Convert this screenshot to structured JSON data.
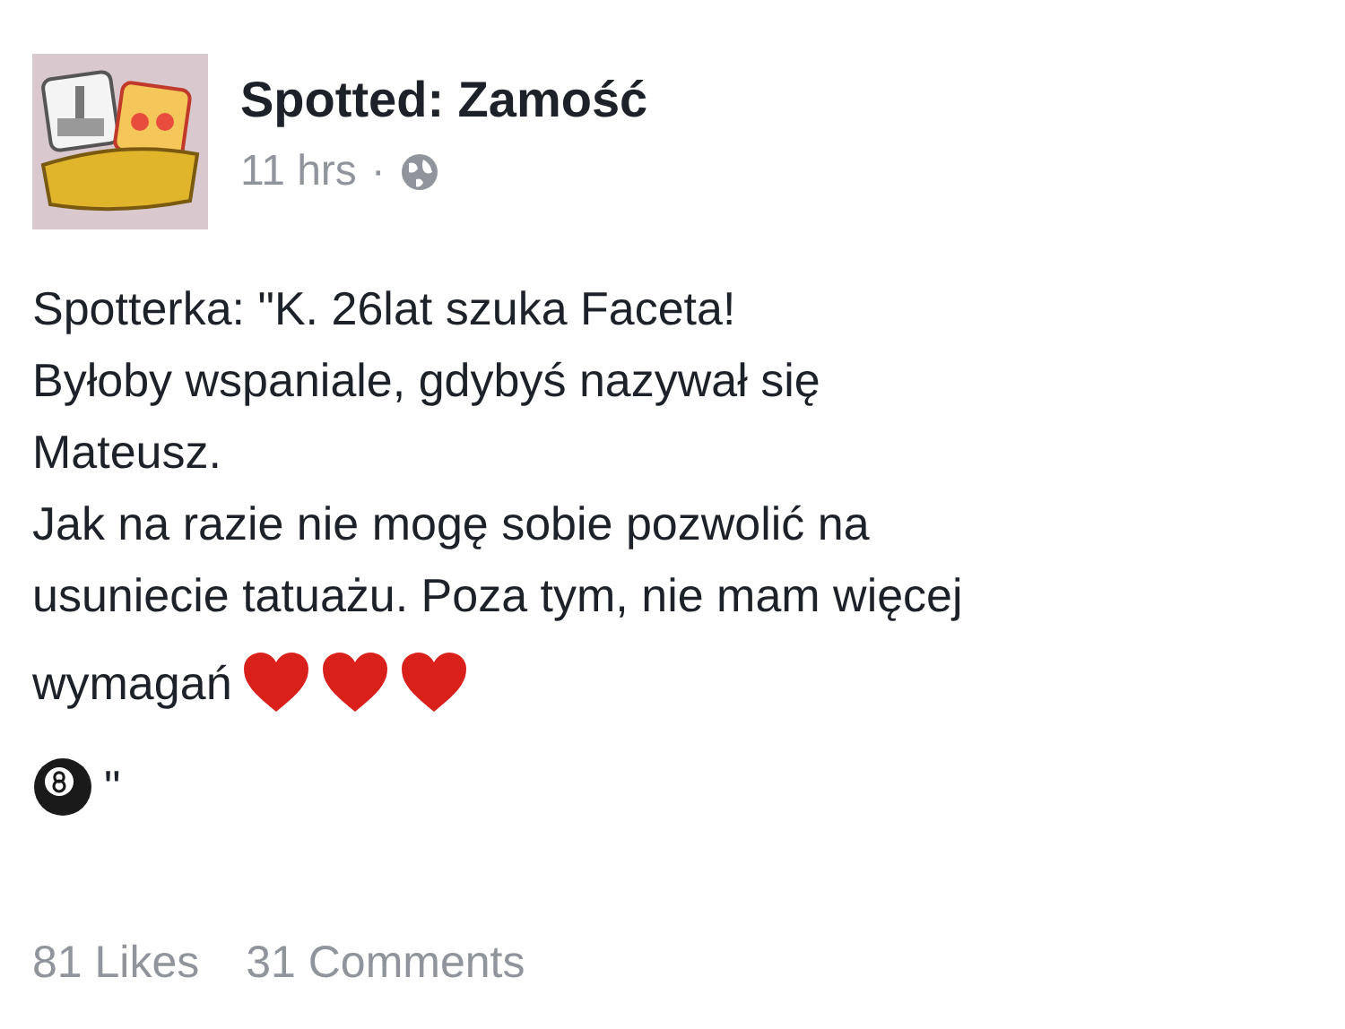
{
  "post": {
    "author": "Spotted: Zamość",
    "time": "11 hrs",
    "separator": "·",
    "audience": {
      "kind": "globe"
    },
    "lines": [
      {
        "text": "Spotterka: \"K. 26lat szuka Faceta!"
      },
      {
        "text": "Byłoby wspaniale, gdybyś nazywał się"
      },
      {
        "text": "Mateusz."
      },
      {
        "text": "Jak na razie nie mogę sobie pozwolić na"
      },
      {
        "text": "usuniecie tatuażu. Poza tym, nie mam więcej"
      },
      {
        "text": "wymagań",
        "after": [
          {
            "kind": "heart"
          },
          {
            "kind": "heart"
          },
          {
            "kind": "heart"
          }
        ]
      },
      {
        "text": "\"",
        "before": [
          {
            "kind": "eight_ball"
          }
        ]
      }
    ],
    "likes": "81 Likes",
    "comments": "31 Comments"
  }
}
